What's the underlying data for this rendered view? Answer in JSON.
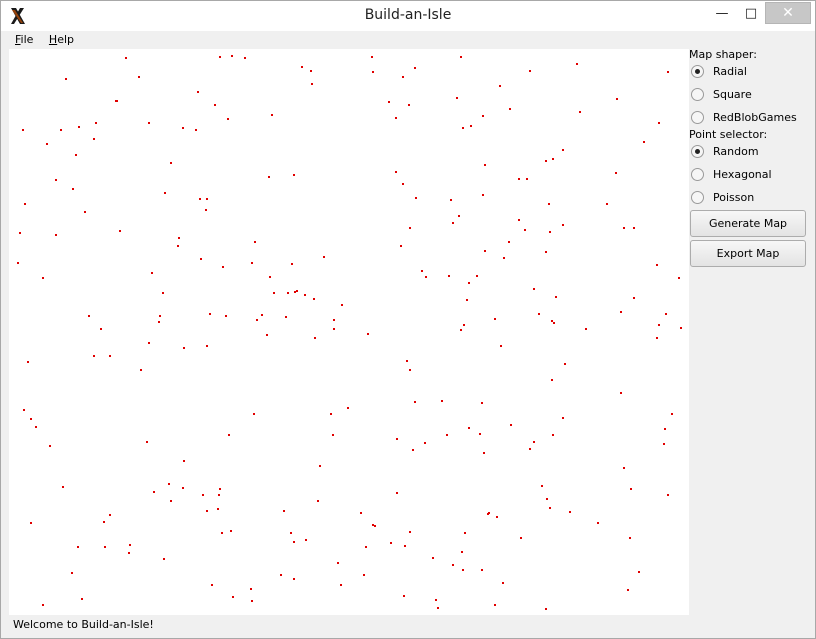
{
  "window": {
    "title": "Build-an-Isle",
    "minimize_glyph": "—",
    "maximize_glyph": "□",
    "close_glyph": "✕",
    "app_icon": "x-logo-icon"
  },
  "menubar": {
    "items": [
      {
        "label": "File",
        "mnemonic": "F",
        "rest": "ile"
      },
      {
        "label": "Help",
        "mnemonic": "H",
        "rest": "elp"
      }
    ]
  },
  "sidebar": {
    "map_shaper": {
      "label": "Map shaper:",
      "options": [
        {
          "label": "Radial",
          "selected": true
        },
        {
          "label": "Square",
          "selected": false
        },
        {
          "label": "RedBlobGames",
          "selected": false
        }
      ]
    },
    "point_selector": {
      "label": "Point selector:",
      "options": [
        {
          "label": "Random",
          "selected": true
        },
        {
          "label": "Hexagonal",
          "selected": false
        },
        {
          "label": "Poisson",
          "selected": false
        }
      ]
    },
    "generate_label": "Generate Map",
    "export_label": "Export Map"
  },
  "canvas": {
    "point_color": "#e00000",
    "background": "#ffffff"
  },
  "status": {
    "text": "Welcome to Build-an-Isle!"
  }
}
